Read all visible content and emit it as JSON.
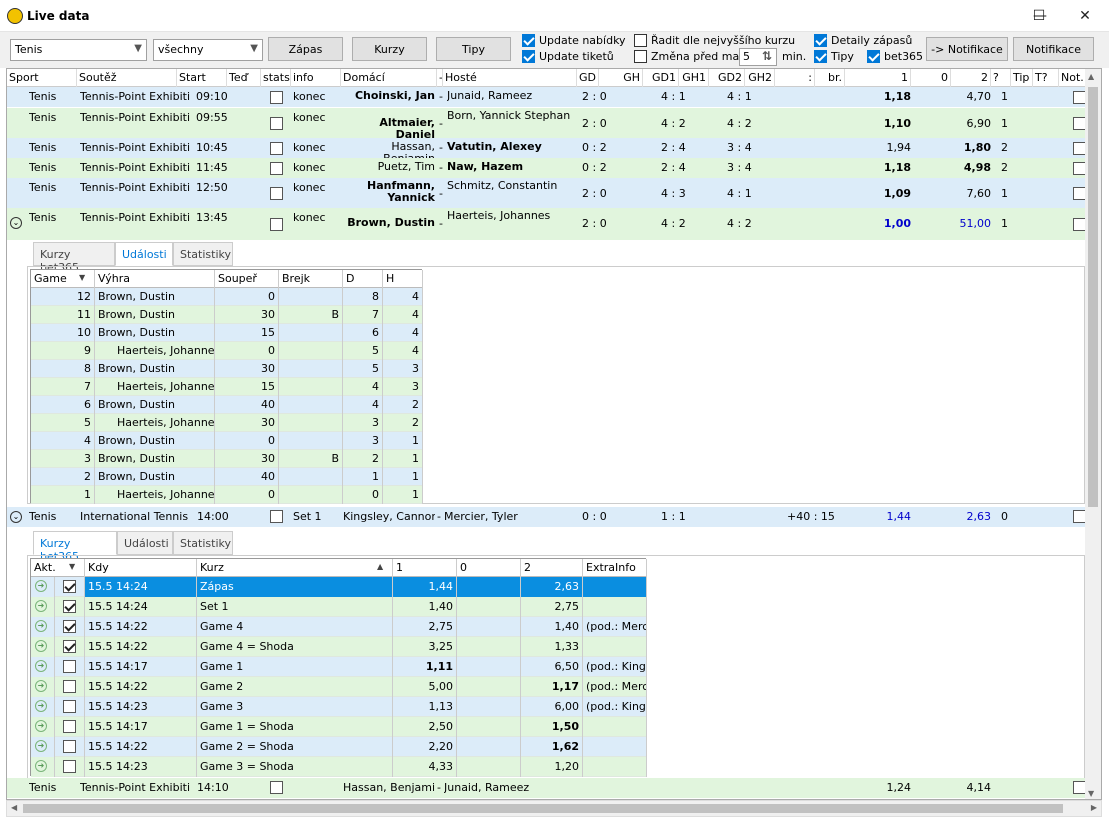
{
  "window": {
    "title": "Live data",
    "min": "—",
    "max": "☐",
    "close": "✕"
  },
  "toolbar": {
    "sport": "Tenis",
    "filter": "všechny",
    "btn_zapas": "Zápas",
    "btn_kurzy": "Kurzy",
    "btn_tipy": "Tipy",
    "update_nabidky": "Update nabídky",
    "update_tiketu": "Update tiketů",
    "radit": "Řadit dle nejvyššího kurzu",
    "zmena": "Změna před max",
    "minutes": "5",
    "min_label": "min.",
    "detaily": "Detaily zápasů",
    "tipy": "Tipy",
    "bet365": "bet365",
    "btn_to_notif": "-> Notifikace",
    "btn_notif": "Notifikace"
  },
  "columns": [
    "Sport",
    "Soutěž",
    "Start",
    "Teď",
    "stats",
    "info",
    "Domácí",
    "-",
    "Hosté",
    "GD",
    "GH",
    "GD1",
    "GH1",
    "GD2",
    "GH2",
    ":",
    "br.",
    "1",
    "0",
    "2",
    "?",
    "Tip",
    "T?",
    "Not."
  ],
  "matches": [
    {
      "sport": "Tenis",
      "comp": "Tennis-Point Exhibiti",
      "start": "09:10",
      "info": "konec",
      "home": "Choinski, Jan",
      "away": "Junaid, Rameez",
      "gd": "2 : 0",
      "g1": "4 : 1",
      "g2": "4 : 1",
      "o1": "1,18",
      "o2": "4,70",
      "q": "1"
    },
    {
      "sport": "Tenis",
      "comp": "Tennis-Point Exhibiti",
      "start": "09:55",
      "info": "konec",
      "home": "Altmaier, Daniel",
      "away": "Born, Yannick Stephan",
      "gd": "2 : 0",
      "g1": "4 : 2",
      "g2": "4 : 2",
      "o1": "1,10",
      "o2": "6,90",
      "q": "1"
    },
    {
      "sport": "Tenis",
      "comp": "Tennis-Point Exhibiti",
      "start": "10:45",
      "info": "konec",
      "home": "Hassan, Benjamin",
      "away": "Vatutin, Alexey",
      "gd": "0 : 2",
      "g1": "2 : 4",
      "g2": "3 : 4",
      "o1": "1,94",
      "o2": "1,80",
      "q": "2"
    },
    {
      "sport": "Tenis",
      "comp": "Tennis-Point Exhibiti",
      "start": "11:45",
      "info": "konec",
      "home": "Puetz, Tim",
      "away": "Naw, Hazem",
      "gd": "0 : 2",
      "g1": "2 : 4",
      "g2": "3 : 4",
      "o1": "1,18",
      "o2": "4,98",
      "q": "2"
    },
    {
      "sport": "Tenis",
      "comp": "Tennis-Point Exhibiti",
      "start": "12:50",
      "info": "konec",
      "home": "Hanfmann, Yannick",
      "away": "Schmitz, Constantin",
      "gd": "2 : 0",
      "g1": "4 : 3",
      "g2": "4 : 1",
      "o1": "1,09",
      "o2": "7,60",
      "q": "1"
    },
    {
      "sport": "Tenis",
      "comp": "Tennis-Point Exhibiti",
      "start": "13:45",
      "info": "konec",
      "home": "Brown, Dustin",
      "away": "Haerteis, Johannes",
      "gd": "2 : 0",
      "g1": "4 : 2",
      "g2": "4 : 2",
      "o1": "1,00",
      "o2": "51,00",
      "q": "1"
    }
  ],
  "tabs1": [
    "Kurzy bet365",
    "Události",
    "Statistiky"
  ],
  "events_cols": [
    "Game",
    "Výhra",
    "Soupeř",
    "Brejk",
    "D",
    "H"
  ],
  "events": [
    [
      "12",
      "Brown, Dustin",
      "0",
      "",
      "8",
      "4"
    ],
    [
      "11",
      "Brown, Dustin",
      "30",
      "B",
      "7",
      "4"
    ],
    [
      "10",
      "Brown, Dustin",
      "15",
      "",
      "6",
      "4"
    ],
    [
      "9",
      "Haerteis, Johannes",
      "0",
      "",
      "5",
      "4"
    ],
    [
      "8",
      "Brown, Dustin",
      "30",
      "",
      "5",
      "3"
    ],
    [
      "7",
      "Haerteis, Johannes",
      "15",
      "",
      "4",
      "3"
    ],
    [
      "6",
      "Brown, Dustin",
      "40",
      "",
      "4",
      "2"
    ],
    [
      "5",
      "Haerteis, Johannes",
      "30",
      "",
      "3",
      "2"
    ],
    [
      "4",
      "Brown, Dustin",
      "0",
      "",
      "3",
      "1"
    ],
    [
      "3",
      "Brown, Dustin",
      "30",
      "B",
      "2",
      "1"
    ],
    [
      "2",
      "Brown, Dustin",
      "40",
      "",
      "1",
      "1"
    ],
    [
      "1",
      "Haerteis, Johannes",
      "0",
      "",
      "0",
      "1"
    ]
  ],
  "live": {
    "sport": "Tenis",
    "comp": "International Tennis",
    "start": "14:00",
    "info": "Set 1",
    "home": "Kingsley, Cannon",
    "away": "Mercier, Tyler",
    "gd": "0 : 0",
    "g1": "1 : 1",
    "score": "+40 : 15",
    "o1": "1,44",
    "o2": "2,63",
    "q": "0"
  },
  "tabs2": [
    "Kurzy bet365",
    "Události",
    "Statistiky"
  ],
  "odds_cols": [
    "Akt.",
    "Kdy",
    "Kurz",
    "1",
    "0",
    "2",
    "ExtraInfo"
  ],
  "odds": [
    {
      "chk": true,
      "kdy": "15.5 14:24",
      "kurz": "Zápas",
      "o1": "1,44",
      "o2": "2,63",
      "extra": "",
      "b1": false,
      "b2": false
    },
    {
      "chk": true,
      "kdy": "15.5 14:24",
      "kurz": "Set 1",
      "o1": "1,40",
      "o2": "2,75",
      "extra": "",
      "b1": false,
      "b2": false
    },
    {
      "chk": true,
      "kdy": "15.5 14:22",
      "kurz": "Game 4",
      "o1": "2,75",
      "o2": "1,40",
      "extra": "(pod.: Merc",
      "b1": false,
      "b2": false
    },
    {
      "chk": true,
      "kdy": "15.5 14:22",
      "kurz": "Game 4 = Shoda",
      "o1": "3,25",
      "o2": "1,33",
      "extra": "",
      "b1": false,
      "b2": false
    },
    {
      "chk": false,
      "kdy": "15.5 14:17",
      "kurz": "Game 1",
      "o1": "1,11",
      "o2": "6,50",
      "extra": "(pod.: Kings",
      "b1": true,
      "b2": false
    },
    {
      "chk": false,
      "kdy": "15.5 14:22",
      "kurz": "Game 2",
      "o1": "5,00",
      "o2": "1,17",
      "extra": "(pod.: Merc",
      "b1": false,
      "b2": true
    },
    {
      "chk": false,
      "kdy": "15.5 14:23",
      "kurz": "Game 3",
      "o1": "1,13",
      "o2": "6,00",
      "extra": "(pod.: Kings",
      "b1": false,
      "b2": false
    },
    {
      "chk": false,
      "kdy": "15.5 14:17",
      "kurz": "Game 1 = Shoda",
      "o1": "2,50",
      "o2": "1,50",
      "extra": "",
      "b1": false,
      "b2": true
    },
    {
      "chk": false,
      "kdy": "15.5 14:22",
      "kurz": "Game 2 = Shoda",
      "o1": "2,20",
      "o2": "1,62",
      "extra": "",
      "b1": false,
      "b2": true
    },
    {
      "chk": false,
      "kdy": "15.5 14:23",
      "kurz": "Game 3 = Shoda",
      "o1": "4,33",
      "o2": "1,20",
      "extra": "",
      "b1": false,
      "b2": false
    }
  ],
  "last": {
    "sport": "Tenis",
    "comp": "Tennis-Point Exhibiti",
    "start": "14:10",
    "home": "Hassan, Benjamin",
    "away": "Junaid, Rameez",
    "o1": "1,24",
    "o2": "4,14"
  }
}
